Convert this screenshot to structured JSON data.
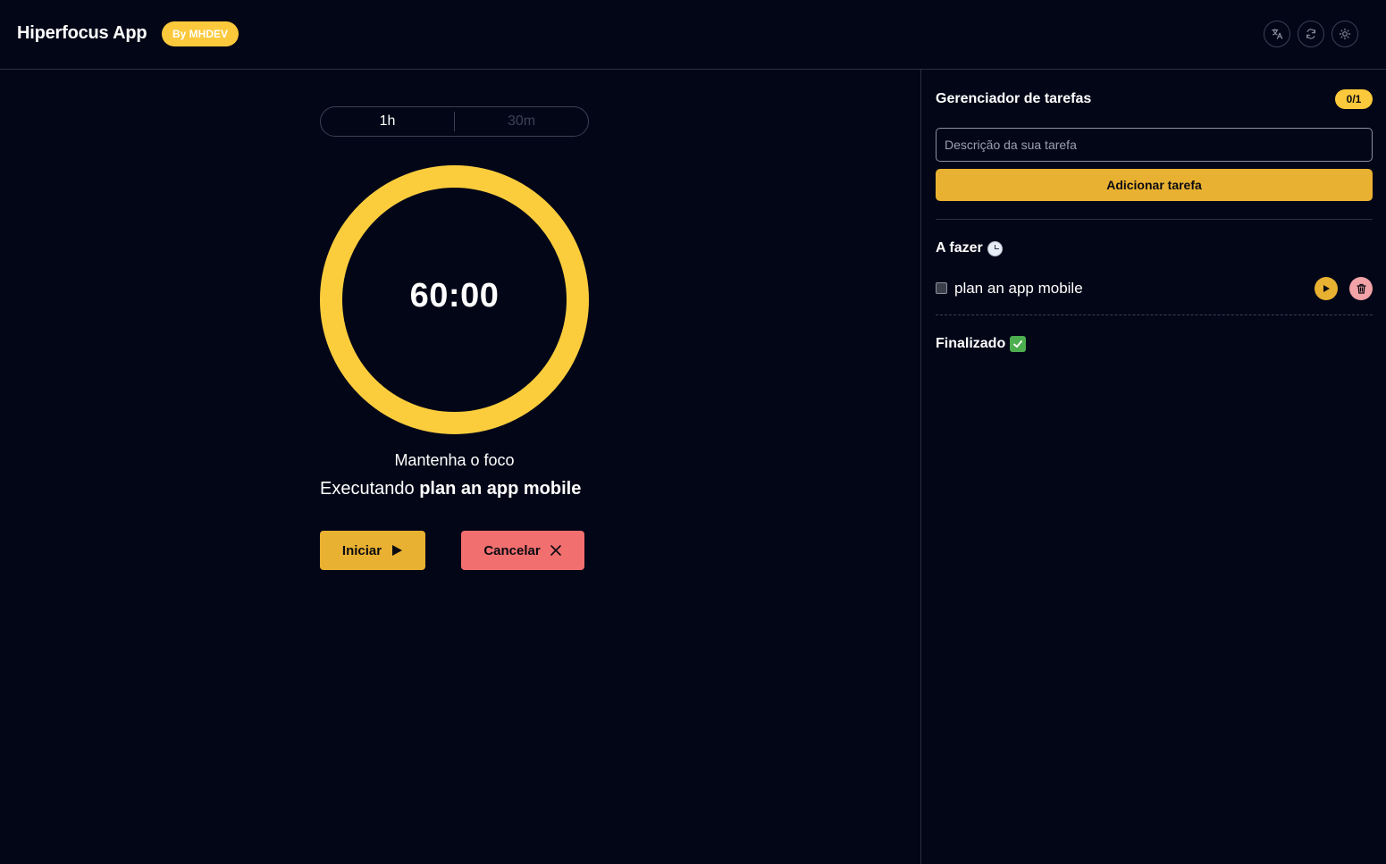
{
  "header": {
    "title": "Hiperfocus App",
    "badge": "By MHDEV",
    "icons": [
      "translate-icon",
      "refresh-icon",
      "sun-icon"
    ]
  },
  "timer": {
    "durations": [
      {
        "label": "1h",
        "active": true
      },
      {
        "label": "30m",
        "active": false
      }
    ],
    "time": "60:00",
    "progress": 1.0,
    "ring_color": "#fbcd3c",
    "focus_message": "Mantenha o foco",
    "executing_prefix": "Executando",
    "executing_task": "plan an app mobile",
    "start_label": "Iniciar",
    "cancel_label": "Cancelar"
  },
  "tasks_panel": {
    "title": "Gerenciador de tarefas",
    "count": "0/1",
    "input_placeholder": "Descrição da sua tarefa",
    "add_label": "Adicionar tarefa",
    "todo_title": "A fazer",
    "done_title": "Finalizado",
    "todo_items": [
      {
        "label": "plan an app mobile",
        "checked": false
      }
    ]
  },
  "colors": {
    "background": "#030617",
    "accent": "#e9b131",
    "danger": "#f26f6f"
  }
}
